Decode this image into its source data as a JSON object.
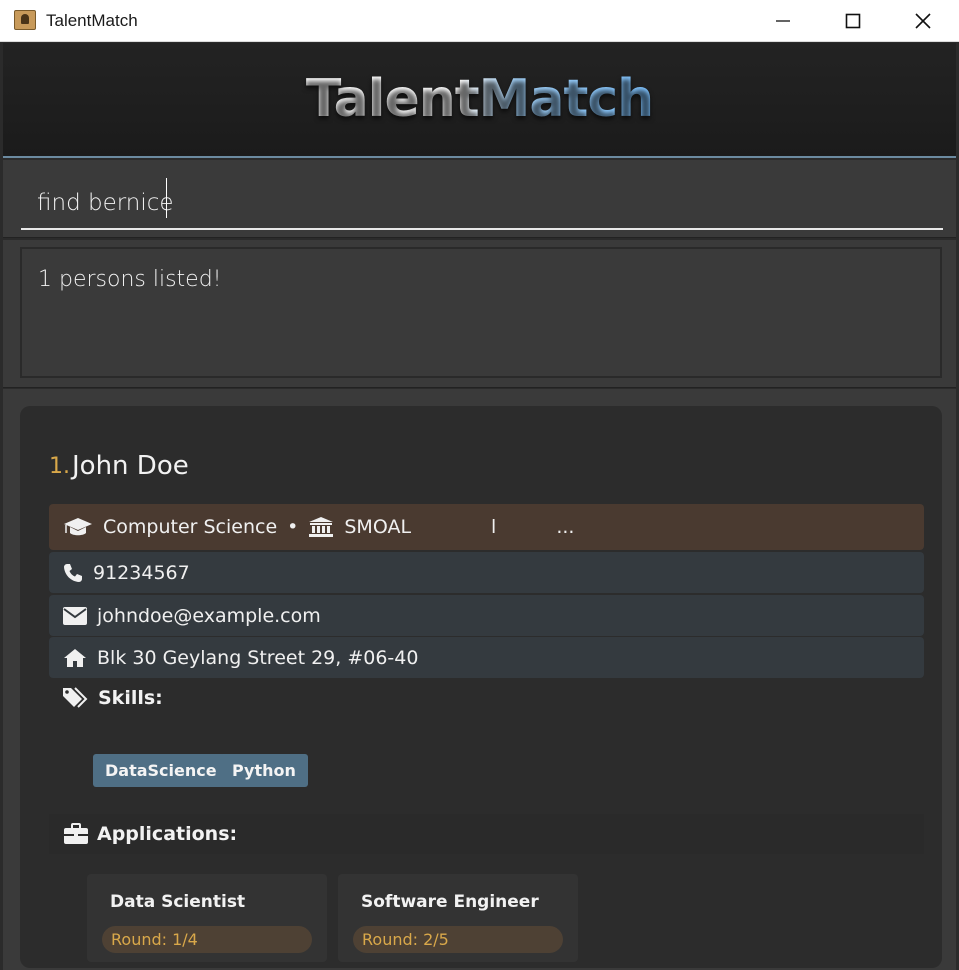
{
  "window": {
    "title": "TalentMatch"
  },
  "header": {
    "title": "TalentMatch"
  },
  "command": {
    "value": "find bernice"
  },
  "result": {
    "message": "1 persons listed!"
  },
  "person": {
    "index": "1.",
    "name": "John Doe",
    "education": "Computer Science",
    "separator": "•",
    "university": "SMOAL",
    "extra_a": "l",
    "extra_b": "...",
    "phone": "91234567",
    "email": "johndoe@example.com",
    "address": "Blk 30 Geylang Street 29, #06-40",
    "skills_label": "Skills:",
    "skills": [
      "DataScience",
      "Python"
    ],
    "applications_label": "Applications:",
    "applications": [
      {
        "title": "Data Scientist",
        "round": "Round: 1/4"
      },
      {
        "title": "Software Engineer",
        "round": "Round: 2/5"
      }
    ]
  },
  "icons": {
    "app": "app-icon",
    "minimize": "minimize-icon",
    "maximize": "maximize-icon",
    "close": "close-icon",
    "education": "graduation-cap-icon",
    "university": "university-icon",
    "phone": "phone-icon",
    "email": "envelope-icon",
    "address": "home-icon",
    "skills": "tags-icon",
    "applications": "briefcase-icon"
  },
  "colors": {
    "accent": "#d9a84a",
    "tag": "#4f6f85",
    "education_row": "#4a3a30",
    "info_row": "#343a3f"
  }
}
